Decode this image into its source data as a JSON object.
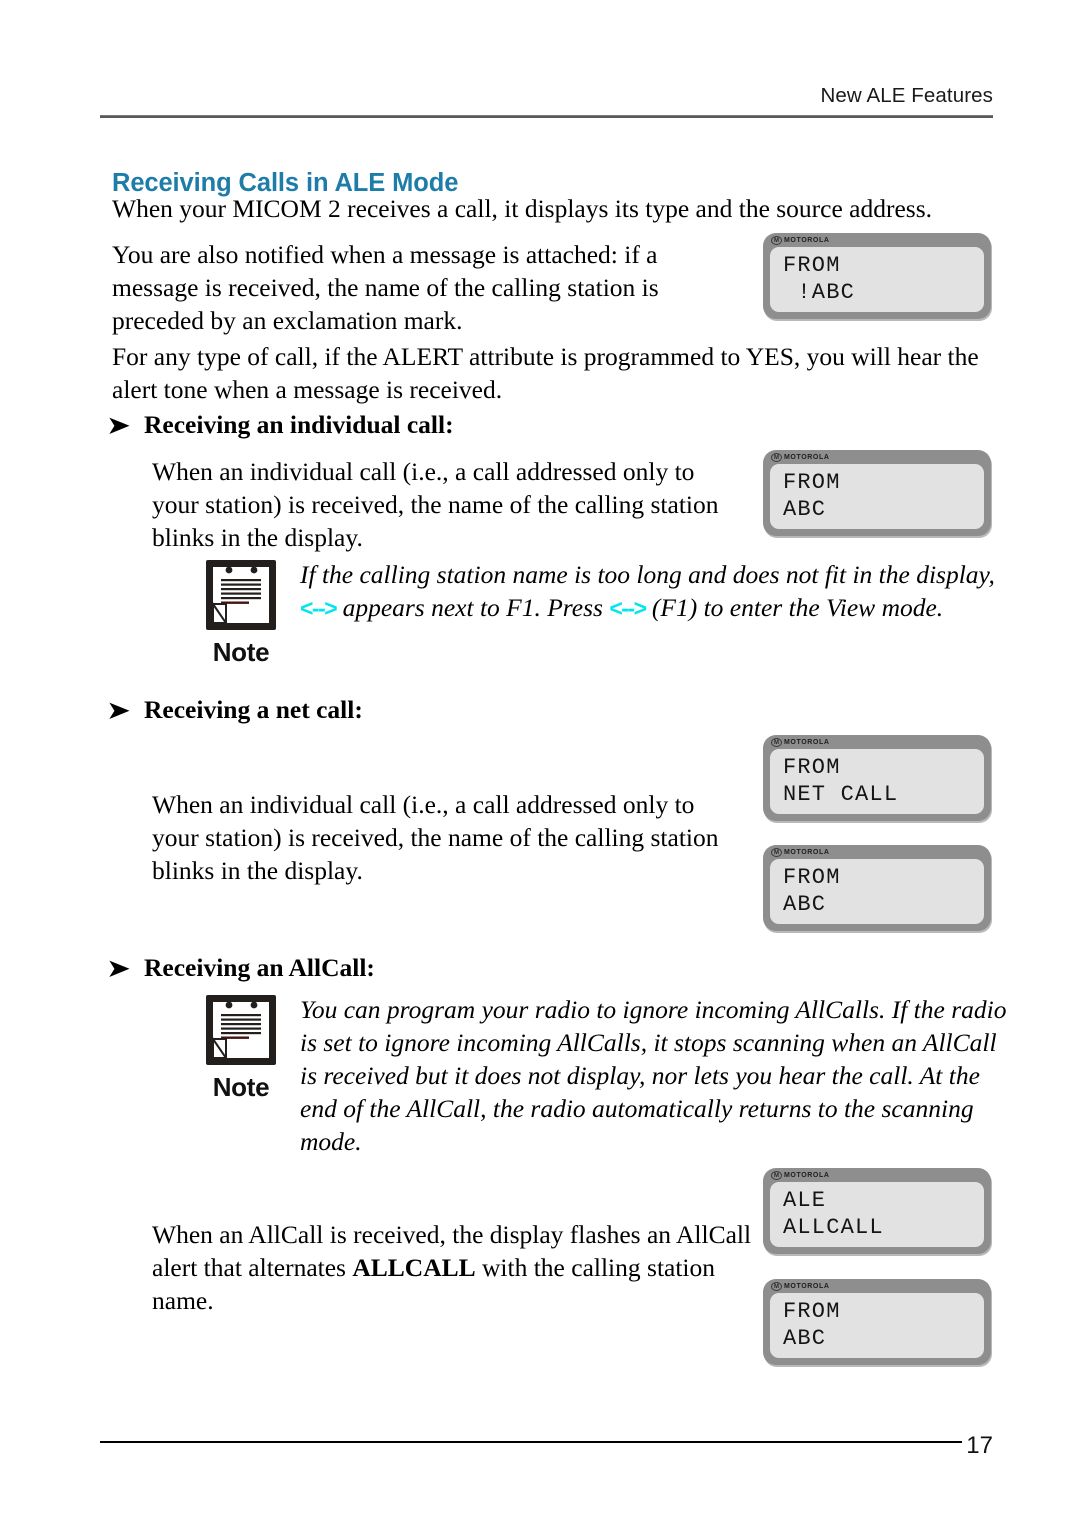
{
  "header": {
    "running_head": "New ALE Features"
  },
  "section": {
    "title": "Receiving Calls in ALE Mode",
    "accent_color": "#1d7da8"
  },
  "intro": {
    "paragraph_1": "When your MICOM 2 receives a call, it displays its type and the source address.",
    "paragraph_2": "You are also notified when a message is attached: if a message is received, the name of the calling station is preceded by an exclamation mark.",
    "paragraph_3": "For any type of call, if the ALERT attribute is programmed to YES, you will hear the alert tone when a message is received."
  },
  "individual_call": {
    "heading": "Receiving an individual call:",
    "bullet_glyph": "➤",
    "body": "When an individual call (i.e., a call addressed only to your station) is received, the name of the calling station blinks in the display.",
    "note": {
      "label": "Note",
      "icon": "note-page-icon",
      "text_part_1": "If the calling station name is too long and does not fit in the display, ",
      "arrow_1": "<-->",
      "text_part_2": " appears next to F1. Press ",
      "arrow_2": "<-->",
      "text_part_3": " (F1) to enter the View mode.",
      "arrow_color": "#00e5ef"
    }
  },
  "net_call": {
    "heading": "Receiving a net call:",
    "bullet_glyph": "➤",
    "body": "When an individual call (i.e., a call addressed only to your station) is received, the name of the calling station blinks in the display."
  },
  "allcall": {
    "heading": "Receiving an AllCall:",
    "bullet_glyph": "➤",
    "note": {
      "label": "Note",
      "icon": "note-page-icon",
      "text": "You can program your radio to ignore incoming AllCalls. If the radio is set to ignore incoming AllCalls, it stops scanning when an AllCall is received but it does not display, nor lets you hear the call. At the end of the AllCall, the radio automatically returns to the scanning mode."
    },
    "body_part_1": "When an AllCall is received, the display flashes an AllCall alert that alternates ",
    "body_bold": "ALLCALL",
    "body_part_2": " with the calling station name."
  },
  "displays": {
    "brand": "MOTOROLA",
    "brand_mark": "M",
    "screens": [
      {
        "name": "from-exclamation-abc",
        "line1": "FROM",
        "line2": " !ABC"
      },
      {
        "name": "from-abc-individual",
        "line1": "FROM",
        "line2": "ABC"
      },
      {
        "name": "from-net-call",
        "line1": "FROM",
        "line2": "NET CALL"
      },
      {
        "name": "from-abc-net",
        "line1": "FROM",
        "line2": "ABC"
      },
      {
        "name": "ale-allcall",
        "line1": "ALE",
        "line2": "ALLCALL"
      },
      {
        "name": "from-abc-allcall",
        "line1": "FROM",
        "line2": "ABC"
      }
    ]
  },
  "footer": {
    "page_number": "17"
  }
}
